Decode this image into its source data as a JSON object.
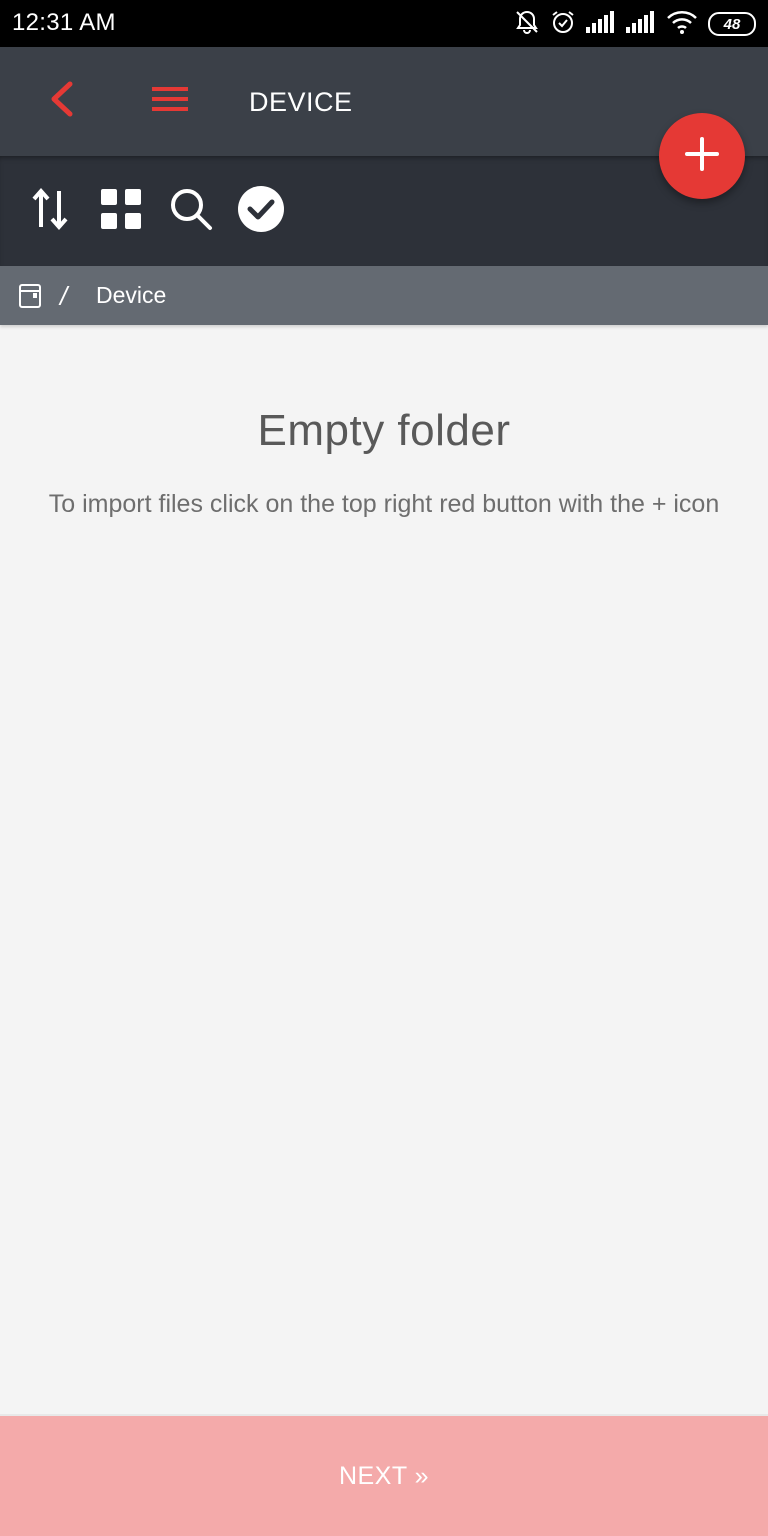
{
  "status_bar": {
    "time": "12:31 AM",
    "battery": "48",
    "icons": [
      "bell-off-icon",
      "alarm-icon",
      "signal-icon",
      "signal-icon",
      "wifi-icon",
      "battery-icon"
    ]
  },
  "app_bar": {
    "title": "DEVICE",
    "back_icon": "chevron-left-icon",
    "menu_icon": "hamburger-menu-icon",
    "accent_color": "#e53935"
  },
  "toolbar": {
    "icons": [
      "sort-icon",
      "grid-view-icon",
      "search-icon",
      "select-all-check-icon"
    ]
  },
  "fab": {
    "icon": "plus-icon",
    "color": "#e53935"
  },
  "breadcrumb": {
    "separator": "/",
    "current": "Device"
  },
  "empty_state": {
    "title": "Empty folder",
    "description": "To import files click on the top right red button with the + icon"
  },
  "footer": {
    "next_label": "NEXT »",
    "color": "#f4aaaa"
  }
}
